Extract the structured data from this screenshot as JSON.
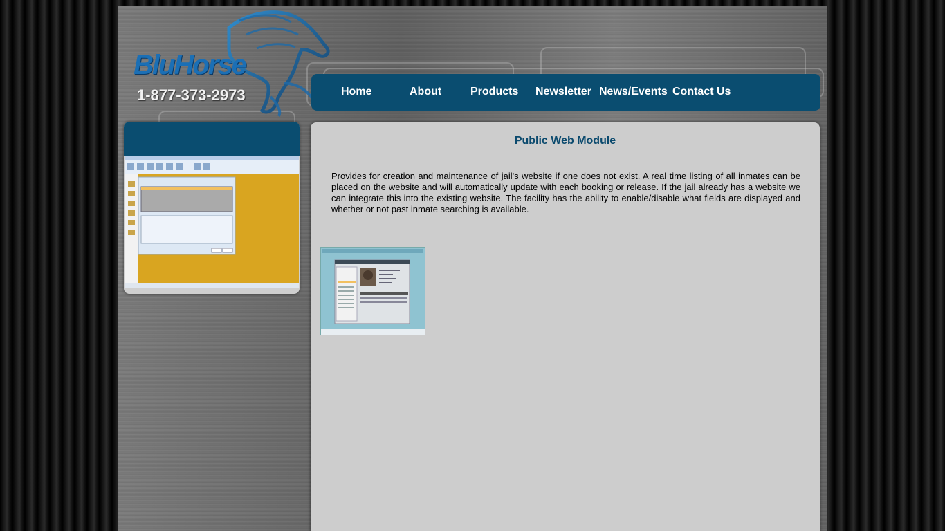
{
  "brand": {
    "name": "BluHorse",
    "phone": "1-877-373-2973"
  },
  "nav": {
    "items": [
      "Home",
      "About",
      "Products",
      "Newsletter",
      "News/Events",
      "Contact Us"
    ]
  },
  "main": {
    "title": "Public Web Module",
    "body": "Provides for creation and maintenance of jail's website if one does not exist. A real time listing of all inmates can be placed on the website and will automatically update with each booking or release. If the jail already has a website we can integrate this into the existing website. The facility has the ability to enable/disable what fields are displayed and whether or not past inmate searching is available."
  },
  "colors": {
    "nav_bg": "#0a4d70",
    "panel_bg": "#cdcdcd",
    "title_color": "#0b4a6e",
    "logo_blue": "#1b6fb5"
  },
  "icons": {
    "logo": "horse-logo-icon"
  }
}
